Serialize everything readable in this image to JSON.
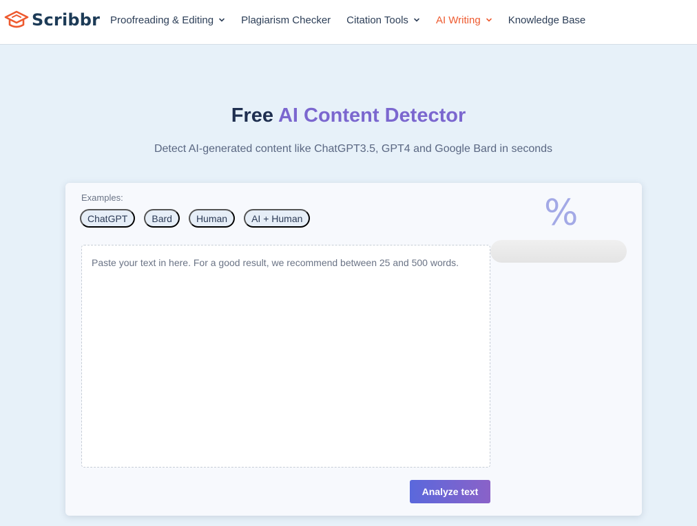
{
  "brand": {
    "name": "Scribbr",
    "accent_color": "#ee5a2f",
    "logo_icon": "graduation-cap-icon"
  },
  "nav": {
    "items": [
      {
        "label": "Proofreading & Editing",
        "has_dropdown": true,
        "active": false
      },
      {
        "label": "Plagiarism Checker",
        "has_dropdown": false,
        "active": false
      },
      {
        "label": "Citation Tools",
        "has_dropdown": true,
        "active": false
      },
      {
        "label": "AI Writing",
        "has_dropdown": true,
        "active": true
      },
      {
        "label": "Knowledge Base",
        "has_dropdown": false,
        "active": false
      }
    ]
  },
  "hero": {
    "title_prefix": "Free",
    "title_accent": "AI Content Detector",
    "subtitle": "Detect AI-generated content like ChatGPT3.5, GPT4 and Google Bard in seconds"
  },
  "detector": {
    "examples_label": "Examples:",
    "examples": [
      "ChatGPT",
      "Bard",
      "Human",
      "AI + Human"
    ],
    "input": {
      "value": "",
      "placeholder": "Paste your text in here. For a good result, we recommend between 25 and 500 words."
    },
    "analyze_label": "Analyze text",
    "result_symbol": "%"
  },
  "colors": {
    "title_accent": "#7b67cf",
    "background": "#e7f1f9",
    "button_start": "#5a68dc",
    "button_end": "#8a62c8"
  }
}
